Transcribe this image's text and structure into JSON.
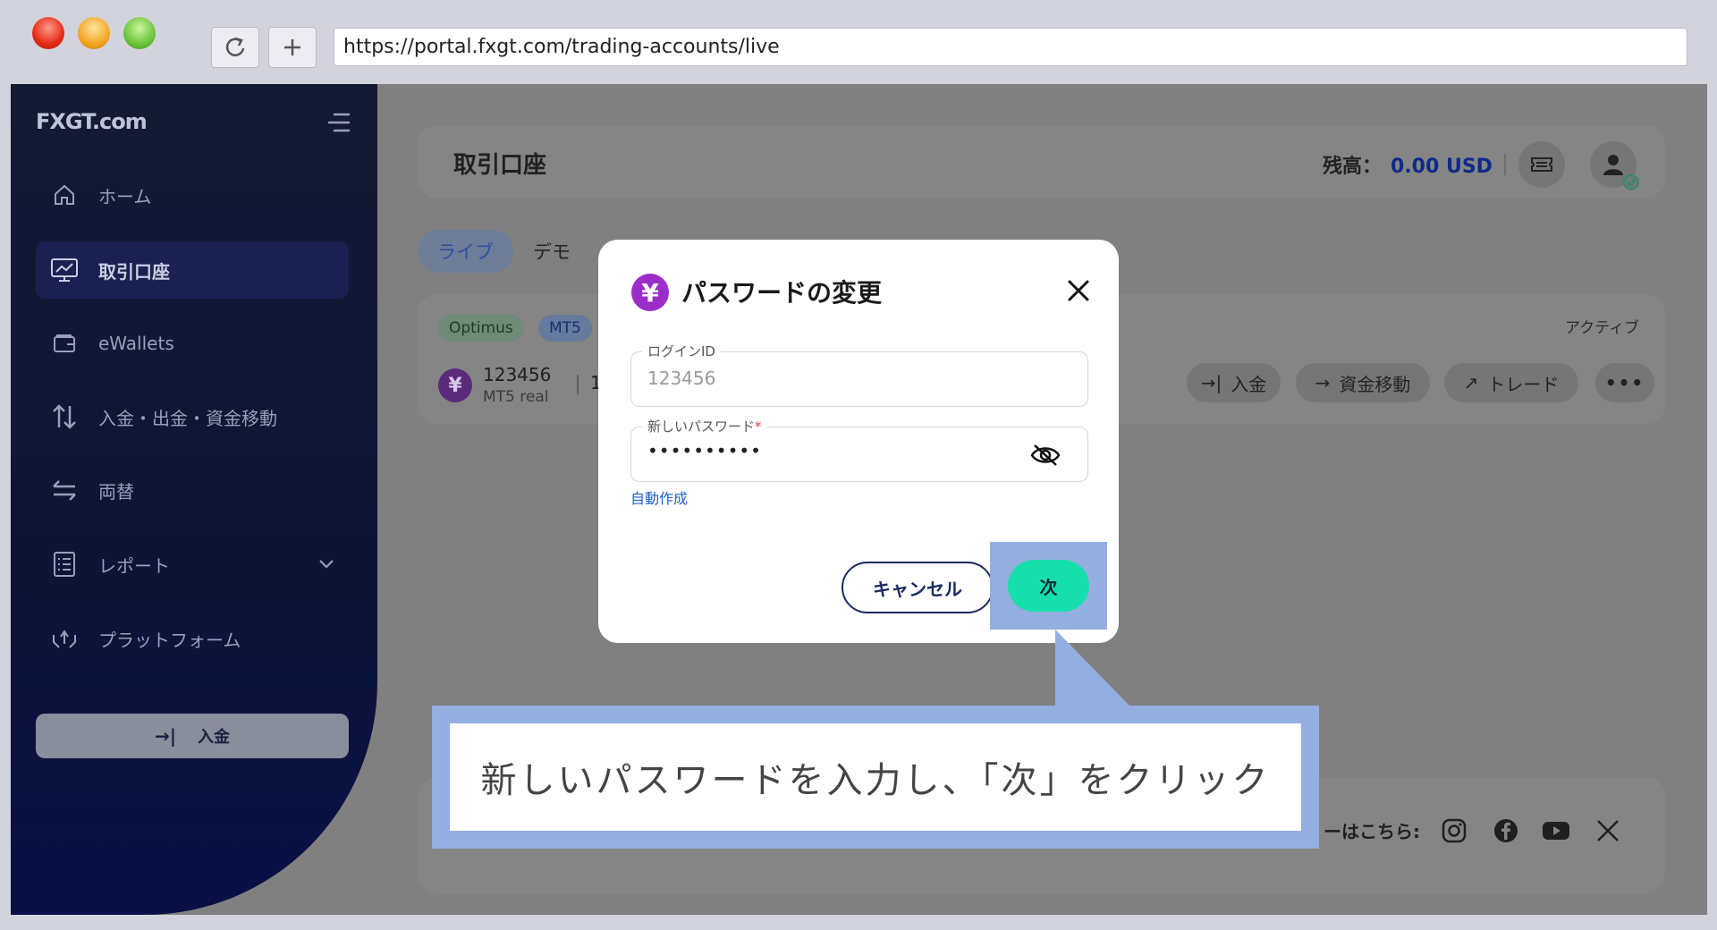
{
  "browser": {
    "url": "https://portal.fxgt.com/trading-accounts/live"
  },
  "sidebar": {
    "logo": "FXGT.com",
    "items": [
      {
        "label": "ホーム"
      },
      {
        "label": "取引口座"
      },
      {
        "label": "eWallets"
      },
      {
        "label": "入金・出金・資金移動"
      },
      {
        "label": "両替"
      },
      {
        "label": "レポート"
      },
      {
        "label": "プラットフォーム"
      }
    ],
    "deposit_button": "入金"
  },
  "header": {
    "title": "取引口座",
    "balance_label": "残高：",
    "balance_value": "0.00 USD"
  },
  "tabs": [
    {
      "label": "ライブ"
    },
    {
      "label": "デモ"
    }
  ],
  "account": {
    "badges": [
      "Optimus",
      "MT5"
    ],
    "status": "アクティブ",
    "number": "123456",
    "type": "MT5 real",
    "partial": "1",
    "actions": [
      "入金",
      "資金移動",
      "トレード"
    ]
  },
  "footer": {
    "social_text": "ーはこちら:"
  },
  "modal": {
    "title": "パスワードの変更",
    "login_label": "ログインID",
    "login_value": "123456",
    "password_label": "新しいパスワード",
    "password_required": "*",
    "password_value": "••••••••••",
    "auto_generate": "自動作成",
    "cancel_label": "キャンセル",
    "next_label": "次"
  },
  "callout": {
    "text": "新しいパスワードを入力し、「次」をクリック"
  }
}
